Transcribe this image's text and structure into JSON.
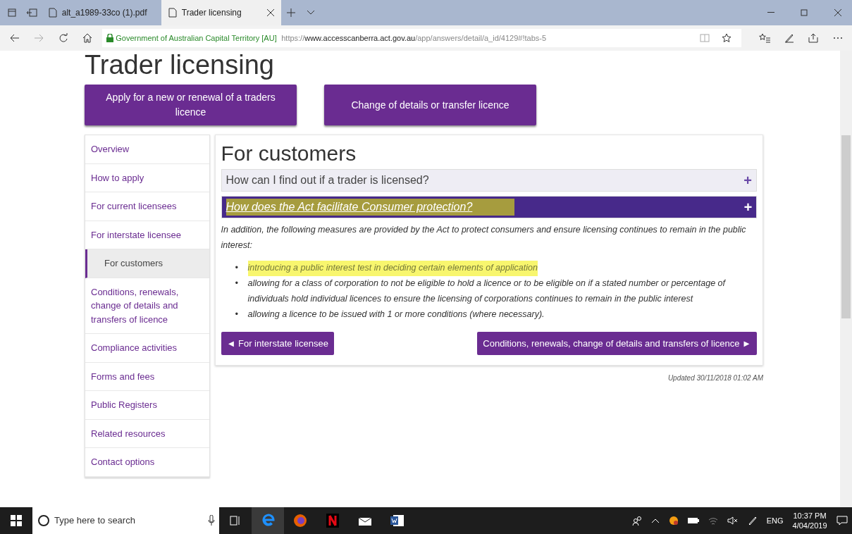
{
  "browser": {
    "tabs": [
      {
        "label": "alt_a1989-33co (1).pdf",
        "selected": false
      },
      {
        "label": "Trader licensing",
        "selected": true
      }
    ],
    "site_identity": "Government of Australian Capital Territory [AU]",
    "url_scheme": "https://",
    "url_domain": "www.accesscanberra.act.gov.au",
    "url_path": "/app/answers/detail/a_id/4129#!tabs-5"
  },
  "page": {
    "title": "Trader licensing",
    "action_buttons": [
      "Apply for a new or renewal of a traders licence",
      "Change of details or transfer licence"
    ],
    "sidebar": [
      {
        "label": "Overview",
        "selected": false
      },
      {
        "label": "How to apply",
        "selected": false
      },
      {
        "label": "For current licensees",
        "selected": false
      },
      {
        "label": "For interstate licensee",
        "selected": false
      },
      {
        "label": "For customers",
        "selected": true
      },
      {
        "label": "Conditions, renewals, change of details and transfers of licence",
        "selected": false
      },
      {
        "label": "Compliance activities",
        "selected": false
      },
      {
        "label": "Forms and fees",
        "selected": false
      },
      {
        "label": "Public Registers",
        "selected": false
      },
      {
        "label": "Related resources",
        "selected": false
      },
      {
        "label": "Contact options",
        "selected": false
      }
    ],
    "section_title": "For customers",
    "accordion": [
      {
        "title": "How can I find out if a trader is licensed?",
        "toggle": "+",
        "expanded": false,
        "highlighted": false
      },
      {
        "title": "How does the Act facilitate Consumer protection?",
        "toggle": "+",
        "expanded": true,
        "highlighted": true,
        "intro": "In addition, the following measures are provided by the Act to protect consumers and ensure licensing continues to remain in the public interest:",
        "bullets": [
          {
            "marker": "•",
            "text": "introducing a public interest test in deciding certain elements of application",
            "highlighted": true
          },
          {
            "marker": "•",
            "text": "allowing for a class of corporation to not be eligible to hold a licence or to be eligible on if a stated number or percentage of individuals hold individual licences to ensure the licensing of corporations continues to remain in the public interest",
            "highlighted": false
          },
          {
            "marker": "•",
            "text": "allowing a licence to be issued with 1 or more conditions (where necessary).",
            "highlighted": false
          }
        ]
      }
    ],
    "prev_button": "◄ For interstate licensee",
    "next_button": "Conditions, renewals, change of details and transfers of licence ►",
    "updated": "Updated 30/11/2018 01:02 AM"
  },
  "taskbar": {
    "search_placeholder": "Type here to search",
    "language": "ENG",
    "time": "10:37 PM",
    "date": "4/04/2019"
  }
}
